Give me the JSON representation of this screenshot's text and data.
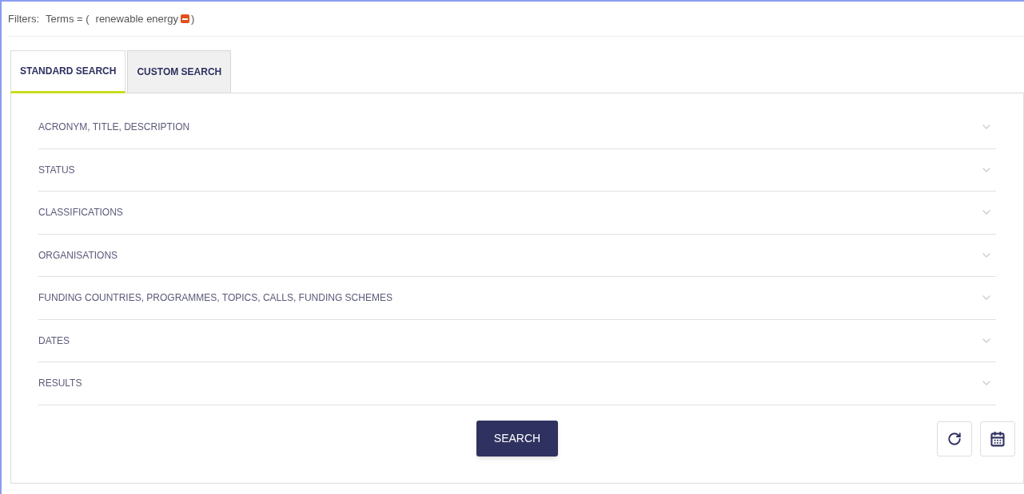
{
  "filters": {
    "label": "Filters:",
    "term_label": "Terms = (",
    "term": "renewable energy",
    "close": ")"
  },
  "tabs": [
    {
      "label": "STANDARD SEARCH",
      "selected": true
    },
    {
      "label": "CUSTOM SEARCH",
      "selected": false
    }
  ],
  "sections": [
    {
      "label": "ACRONYM, TITLE, DESCRIPTION",
      "expanded": false
    },
    {
      "label": "STATUS",
      "expanded": false
    },
    {
      "label": "CLASSIFICATIONS",
      "expanded": false
    },
    {
      "label": "ORGANISATIONS",
      "expanded": false
    },
    {
      "label": "FUNDING COUNTRIES, PROGRAMMES, TOPICS, CALLS, FUNDING SCHEMES",
      "expanded": false
    },
    {
      "label": "DATES",
      "expanded": false
    },
    {
      "label": "RESULTS",
      "expanded": false
    }
  ],
  "search_button": "SEARCH"
}
